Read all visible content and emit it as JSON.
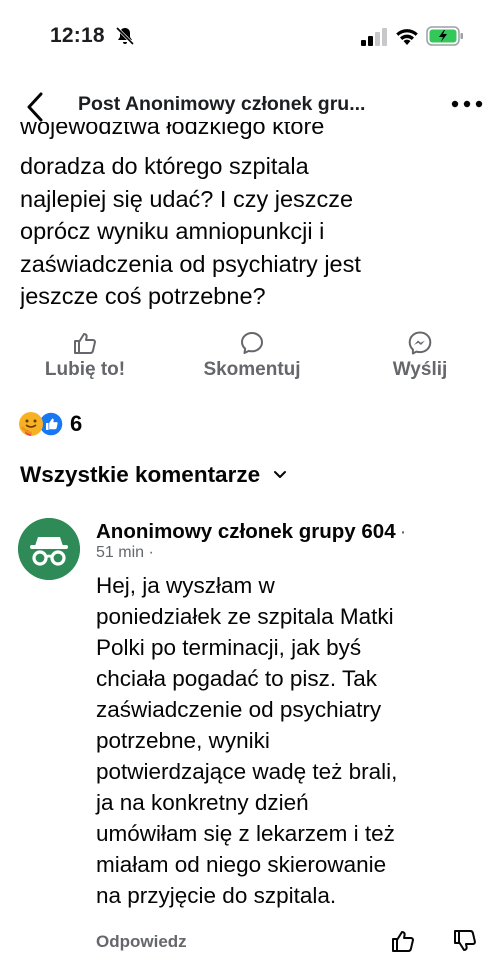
{
  "status_bar": {
    "time": "12:18",
    "icons": [
      "bell-slash-icon",
      "signal-icon",
      "wifi-icon",
      "battery-charging-icon"
    ]
  },
  "nav": {
    "title": "Post Anonimowy członek gru...",
    "icons": [
      "chevron-left-icon",
      "more-icon"
    ]
  },
  "post": {
    "clipped_line": "województwa łódzkiego które",
    "text": "doradza do którego szpitala\nnajlepiej się udać? I czy jeszcze\noprócz wyniku amniopunkcji i\nzaświadczenia od psychiatry jest\njeszcze coś potrzebne?"
  },
  "actions": {
    "like": "Lubię to!",
    "comment": "Skomentuj",
    "share": "Wyślij"
  },
  "reactions": {
    "count": "6",
    "icons": [
      "care-reaction-icon",
      "like-reaction-icon"
    ]
  },
  "comments_section": {
    "title": "Wszystkie komentarze"
  },
  "comment": {
    "author": "Anonimowy członek grupy 604",
    "author_suffix": "·",
    "time": "51 min ·",
    "text": "Hej, ja wyszłam w\nponiedziałek ze szpitala Matki\nPolki po terminacji, jak byś\nchciała pogadać to pisz. Tak\nzaświadczenie od psychiatry\npotrzebne, wyniki\npotwierdzające wadę też brali,\nja na konkretny dzień\numówiłam się z lekarzem i też\nmiałam od niego skierowanie\nna przyjęcie do szpitala.",
    "reply": "Odpowiedz"
  },
  "colors": {
    "text_primary": "#050505",
    "text_secondary": "#65676b",
    "like_blue": "#1877f2",
    "avatar_green": "#2e8b57",
    "battery_green": "#34c759"
  }
}
